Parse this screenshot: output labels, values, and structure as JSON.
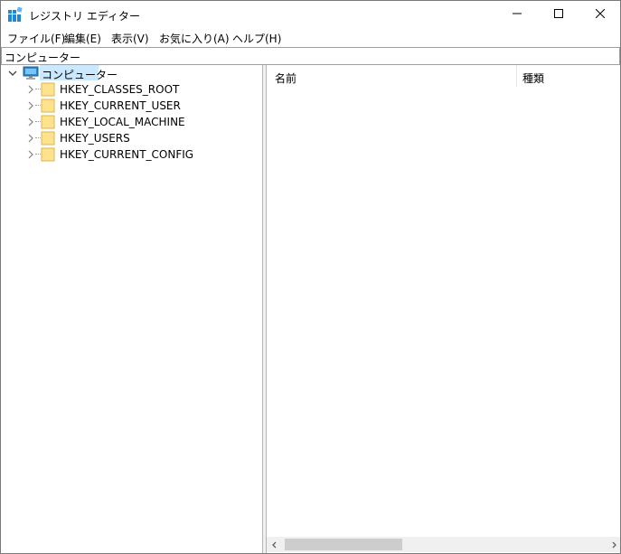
{
  "window": {
    "title": "レジストリ エディター",
    "controls": {
      "minimize": "minimize-icon",
      "maximize": "maximize-icon",
      "close": "close-icon"
    }
  },
  "menu": [
    {
      "label": "ファイル(F)"
    },
    {
      "label": "編集(E)"
    },
    {
      "label": "表示(V)"
    },
    {
      "label": "お気に入り(A)"
    },
    {
      "label": "ヘルプ(H)"
    }
  ],
  "address": {
    "value": "コンピューター"
  },
  "tree": {
    "root": {
      "label": "コンピューター",
      "icon": "computer-icon",
      "expanded": true,
      "selected": true
    },
    "children": [
      {
        "label": "HKEY_CLASSES_ROOT",
        "icon": "folder-icon"
      },
      {
        "label": "HKEY_CURRENT_USER",
        "icon": "folder-icon"
      },
      {
        "label": "HKEY_LOCAL_MACHINE",
        "icon": "folder-icon"
      },
      {
        "label": "HKEY_USERS",
        "icon": "folder-icon"
      },
      {
        "label": "HKEY_CURRENT_CONFIG",
        "icon": "folder-icon"
      }
    ]
  },
  "list": {
    "columns": [
      {
        "label": "名前"
      },
      {
        "label": "種類"
      }
    ]
  },
  "colors": {
    "selection": "#cce8ff",
    "folder": "#ffe38c",
    "folder_edge": "#dcb44c",
    "window_border": "#7a7a7a",
    "scroll_thumb": "#cdcdcd"
  }
}
